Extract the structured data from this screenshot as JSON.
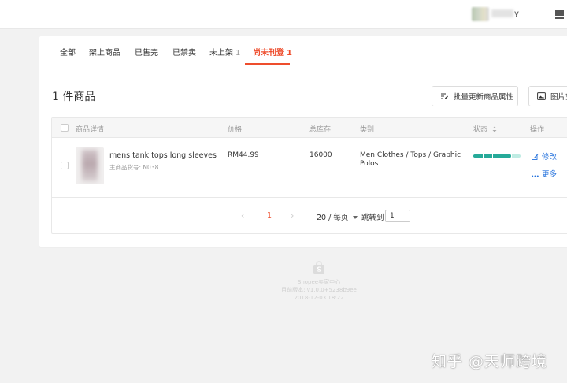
{
  "header": {
    "username_suffix": "y"
  },
  "tabs": [
    {
      "label": "全部",
      "count": ""
    },
    {
      "label": "架上商品",
      "count": ""
    },
    {
      "label": "已售完",
      "count": ""
    },
    {
      "label": "已禁卖",
      "count": ""
    },
    {
      "label": "未上架",
      "count": "1"
    },
    {
      "label": "尚未刊登",
      "count": "1"
    }
  ],
  "active_tab": "尚未刊登",
  "product_count_title": "1 件商品",
  "toolbar": {
    "bulk_update_label": "批量更新商品属性",
    "image_button_label": "图片空"
  },
  "table": {
    "headers": {
      "details": "商品详情",
      "price": "价格",
      "stock": "总库存",
      "category": "类别",
      "status": "状态",
      "actions": "操作"
    },
    "rows": [
      {
        "name": "mens tank tops long sleeves",
        "sku_label": "主商品货号",
        "sku": "N038",
        "price": "RM44.99",
        "stock": "16000",
        "category": "Men Clothes / Tops / Graphic Polos",
        "status_progress": 0.8,
        "edit_label": "修改",
        "more_label": "更多"
      }
    ]
  },
  "pagination": {
    "current_page": "1",
    "page_size_label": "20 / 每页",
    "jump_label": "跳转到",
    "jump_value": "1"
  },
  "footer": {
    "brand": "Shopee卖家中心",
    "version": "目前版本: v1.0.0+5238b9ee",
    "date": "2018-12-03 18:22"
  },
  "watermark": "知乎 @天师跨境",
  "colors": {
    "accent": "#ee4d2d",
    "link": "#2673dd",
    "progress": "#26aa99"
  }
}
